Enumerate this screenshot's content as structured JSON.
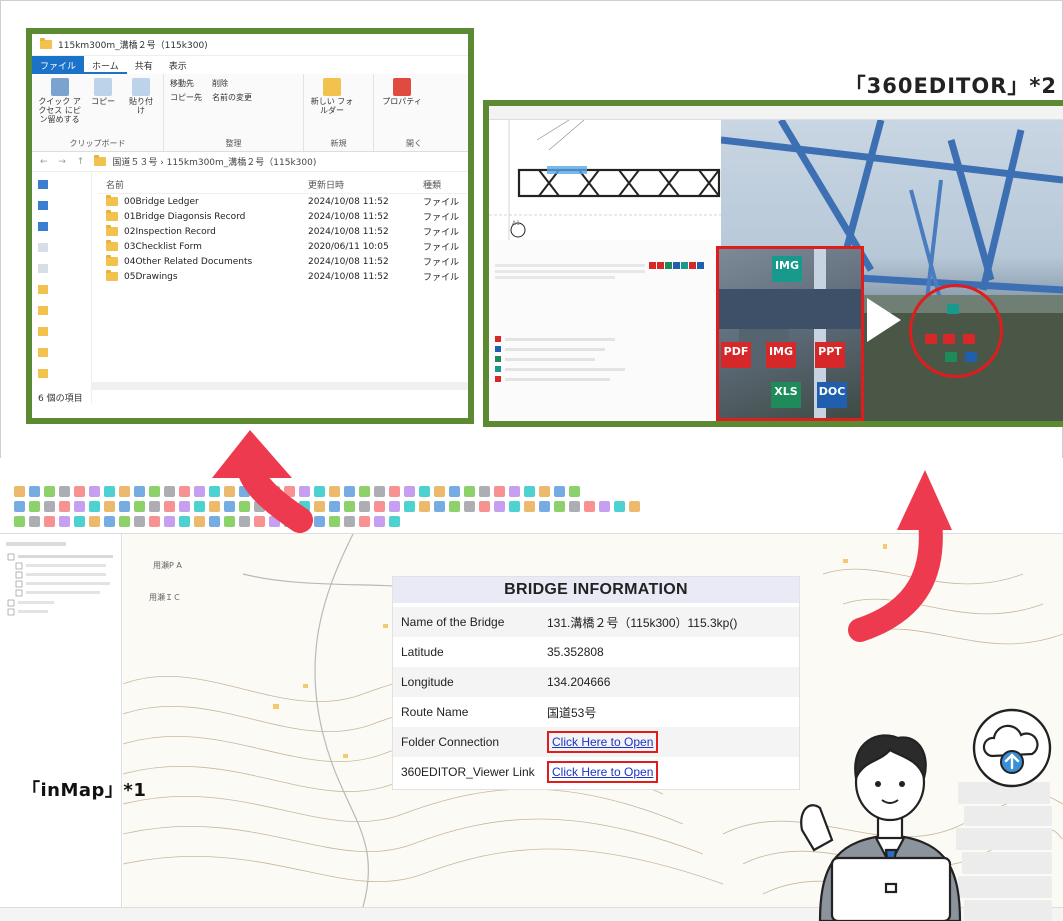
{
  "labels": {
    "editor_label": "「360EDITOR」*2",
    "inmap_label": "「inMap」*1"
  },
  "explorer": {
    "window_title": "115km300m_溝橋２号（115k300)",
    "tabs": [
      "ファイル",
      "ホーム",
      "共有",
      "表示"
    ],
    "ribbon": {
      "pin_label": "クイック アクセス にピン留めする",
      "copy_label": "コピー",
      "paste_label": "貼り付け",
      "clipboard_group": "クリップボード",
      "move_label": "移動先",
      "delete_label": "削除",
      "copy_to_label": "コピー先",
      "rename_label": "名前の変更",
      "organize_group": "整理",
      "new_folder_label": "新しい フォルダー",
      "new_group": "新規",
      "properties_label": "プロパティ",
      "open_group": "開く"
    },
    "address": "国道５３号 › 115km300m_溝橋２号（115k300)",
    "columns": {
      "name": "名前",
      "date": "更新日時",
      "type": "種類"
    },
    "files": [
      {
        "name": "00Bridge Ledger",
        "date": "2024/10/08 11:52",
        "type": "ファイル フ"
      },
      {
        "name": "01Bridge Diagonsis Record",
        "date": "2024/10/08 11:52",
        "type": "ファイル フ"
      },
      {
        "name": "02Inspection Record",
        "date": "2024/10/08 11:52",
        "type": "ファイル フ"
      },
      {
        "name": "03Checklist Form",
        "date": "2020/06/11 10:05",
        "type": "ファイル フ"
      },
      {
        "name": "04Other Related Documents",
        "date": "2024/10/08 11:52",
        "type": "ファイル フ"
      },
      {
        "name": "05Drawings",
        "date": "2024/10/08 11:52",
        "type": "ファイル フ"
      }
    ],
    "status": "6 個の項目"
  },
  "editor": {
    "drawing_label": "A1",
    "tags": {
      "img": "IMG",
      "pdf": "PDF",
      "ppt": "PPT",
      "xls": "XLS",
      "doc": "DOC"
    }
  },
  "map": {
    "label_1": "用瀬P A",
    "label_2": "用瀬ＩＣ"
  },
  "bridge": {
    "title": "BRIDGE INFORMATION",
    "rows": [
      {
        "key": "Name of the Bridge",
        "value": "131.溝橋２号（115k300）115.3kp()"
      },
      {
        "key": "Latitude",
        "value": "35.352808"
      },
      {
        "key": "Longitude",
        "value": "134.204666"
      },
      {
        "key": "Route Name",
        "value": "国道53号"
      }
    ],
    "folder_key": "Folder Connection",
    "folder_link": "Click Here to Open",
    "viewer_key": "360EDITOR_Viewer Link",
    "viewer_link": "Click Here to Open"
  },
  "colors": {
    "frame_green": "#5c8a33",
    "highlight_red": "#e01c1c",
    "arrow_red": "#ee3a4f",
    "link_blue": "#1a33c9"
  }
}
